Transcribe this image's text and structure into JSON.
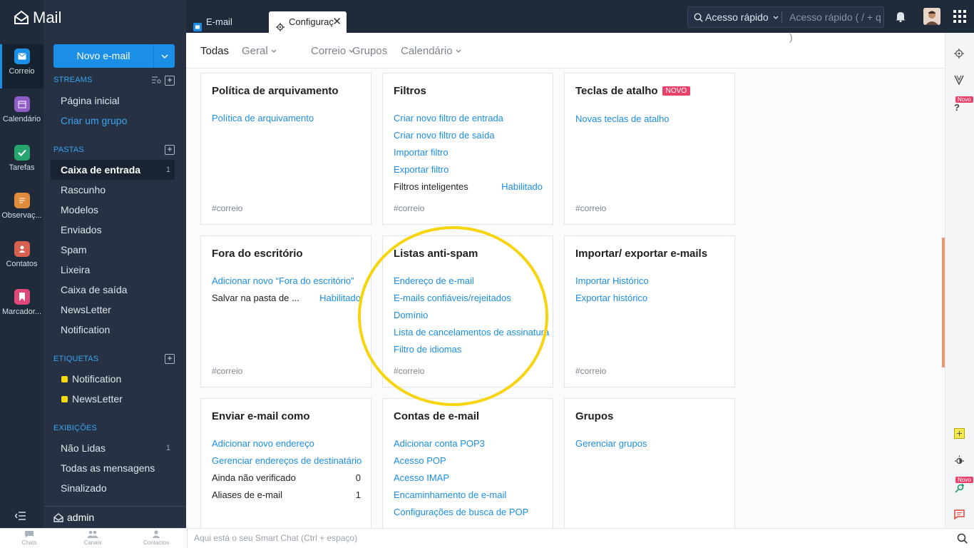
{
  "app": {
    "name": "Mail"
  },
  "rail": [
    {
      "label": "Correio",
      "color": "#1b8ee6"
    },
    {
      "label": "Calendário",
      "color": "#8e5cc4"
    },
    {
      "label": "Tarefas",
      "color": "#27a56e"
    },
    {
      "label": "Observaç...",
      "color": "#e08a3c"
    },
    {
      "label": "Contatos",
      "color": "#d7604e"
    },
    {
      "label": "Marcador...",
      "color": "#e0487a"
    }
  ],
  "folders": {
    "new_mail": "Novo e-mail",
    "streams_head": "STREAMS",
    "streams": [
      "Página inicial",
      "Criar um grupo"
    ],
    "pastas_head": "PASTAS",
    "pastas": [
      {
        "label": "Caixa de entrada",
        "count": "1"
      },
      {
        "label": "Rascunho"
      },
      {
        "label": "Modelos"
      },
      {
        "label": "Enviados"
      },
      {
        "label": "Spam"
      },
      {
        "label": "Lixeira"
      },
      {
        "label": "Caixa de saída"
      },
      {
        "label": "NewsLetter"
      },
      {
        "label": "Notification"
      }
    ],
    "etiquetas_head": "ETIQUETAS",
    "etiquetas": [
      "Notification",
      "NewsLetter"
    ],
    "exibicoes_head": "EXIBIÇÕES",
    "exibicoes": [
      {
        "label": "Não Lidas",
        "count": "1"
      },
      {
        "label": "Todas as mensagens"
      },
      {
        "label": "Sinalizado"
      }
    ],
    "user": "admin"
  },
  "tabs": {
    "email": "E-mail",
    "config": "Configuraç"
  },
  "search": {
    "scope": "Acesso rápido",
    "placeholder": "Acesso rápido  ( / + q )"
  },
  "subtabs": [
    "Todas",
    "Geral",
    "Correio",
    "Grupos",
    "Calendário"
  ],
  "cards": {
    "politica": {
      "title": "Política de arquivamento",
      "links": [
        "Política de arquivamento"
      ],
      "tag": "#correio"
    },
    "filtros": {
      "title": "Filtros",
      "links": [
        "Criar novo filtro de entrada",
        "Criar novo filtro de saída",
        "Importar filtro",
        "Exportar filtro"
      ],
      "row_label": "Filtros inteligentes",
      "row_value": "Habilitado",
      "tag": "#correio"
    },
    "teclas": {
      "title": "Teclas de atalho",
      "badge": "NOVO",
      "links": [
        "Novas teclas de atalho"
      ],
      "tag": "#correio"
    },
    "fora": {
      "title": "Fora do escritório",
      "links": [
        "Adicionar novo “Fora do escritório”"
      ],
      "row_label": "Salvar na pasta de ...",
      "row_value": "Habilitado",
      "tag": "#correio"
    },
    "antispam": {
      "title": "Listas anti-spam",
      "links": [
        "Endereço de e-mail",
        "E-mails confiáveis/rejeitados",
        "Domínio",
        "Lista de cancelamentos de assinatura",
        "Filtro de idiomas"
      ],
      "tag": "#correio"
    },
    "importar": {
      "title": "Importar/ exportar e-mails",
      "links": [
        "Importar Histórico",
        "Exportar histórico"
      ],
      "tag": "#correio"
    },
    "enviar": {
      "title": "Enviar e-mail como",
      "links": [
        "Adicionar novo endereço",
        "Gerenciar endereços de destinatário"
      ],
      "rows": [
        {
          "label": "Ainda não verificado",
          "value": "0"
        },
        {
          "label": "Aliases de e-mail",
          "value": "1"
        }
      ]
    },
    "contas": {
      "title": "Contas de e-mail",
      "links": [
        "Adicionar conta POP3",
        "Acesso POP",
        "Acesso IMAP",
        "Encaminhamento de e-mail",
        "Configurações de busca de POP"
      ]
    },
    "grupos": {
      "title": "Grupos",
      "links": [
        "Gerenciar grupos"
      ]
    }
  },
  "right_rail": {
    "novo": "Novo"
  },
  "bottom": {
    "items": [
      "Chats",
      "Canais",
      "Contactos"
    ],
    "chat_placeholder": "Aqui está o seu Smart Chat (Ctrl + espaço)"
  },
  "colors": {
    "accent": "#1b8ee6",
    "highlight": "#f7d40d",
    "sidebar": "#263244",
    "rail": "#1f2a3a"
  }
}
